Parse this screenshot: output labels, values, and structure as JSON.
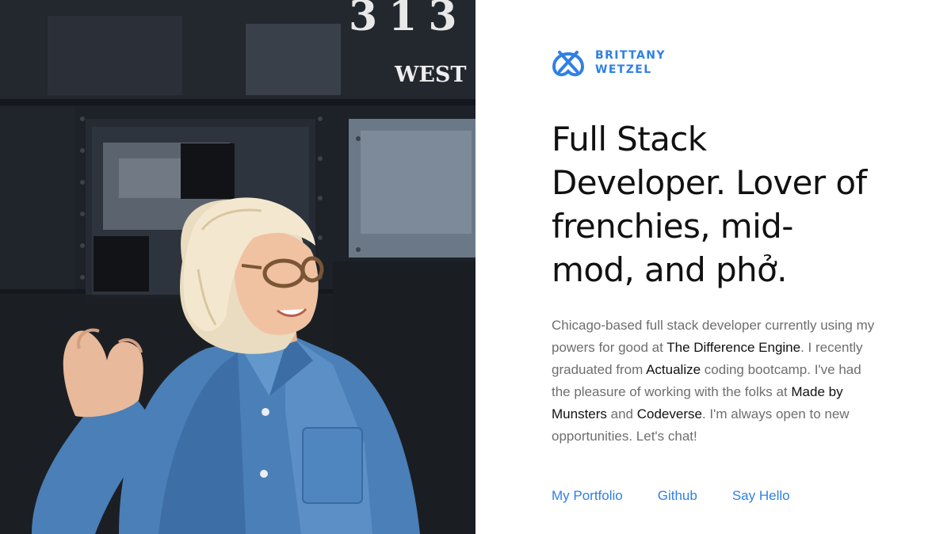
{
  "photo": {
    "sign_number": "313",
    "sign_word": "WEST"
  },
  "brand": {
    "icon": "pretzel-icon",
    "line1": "BRITTANY",
    "line2": "WETZEL",
    "color": "#2f80e6"
  },
  "headline": {
    "line1": "Full Stack",
    "line2": "Developer. Lover of",
    "line3": "frenchies, mid-",
    "line4": "mod, and phở."
  },
  "bio": {
    "part1": "Chicago-based full stack developer currently using my powers for good at ",
    "link1": "The Difference Engine",
    "part2": ". I recently graduated from ",
    "link2": "Actualize",
    "part3": " coding bootcamp. I've had the pleasure of working with the folks at ",
    "link3": "Made by Munsters",
    "part4": " and ",
    "link4": "Codeverse",
    "part5": ". I'm always open to new opportunities. Let's chat!"
  },
  "nav": {
    "portfolio": "My Portfolio",
    "github": "Github",
    "hello": "Say Hello"
  }
}
